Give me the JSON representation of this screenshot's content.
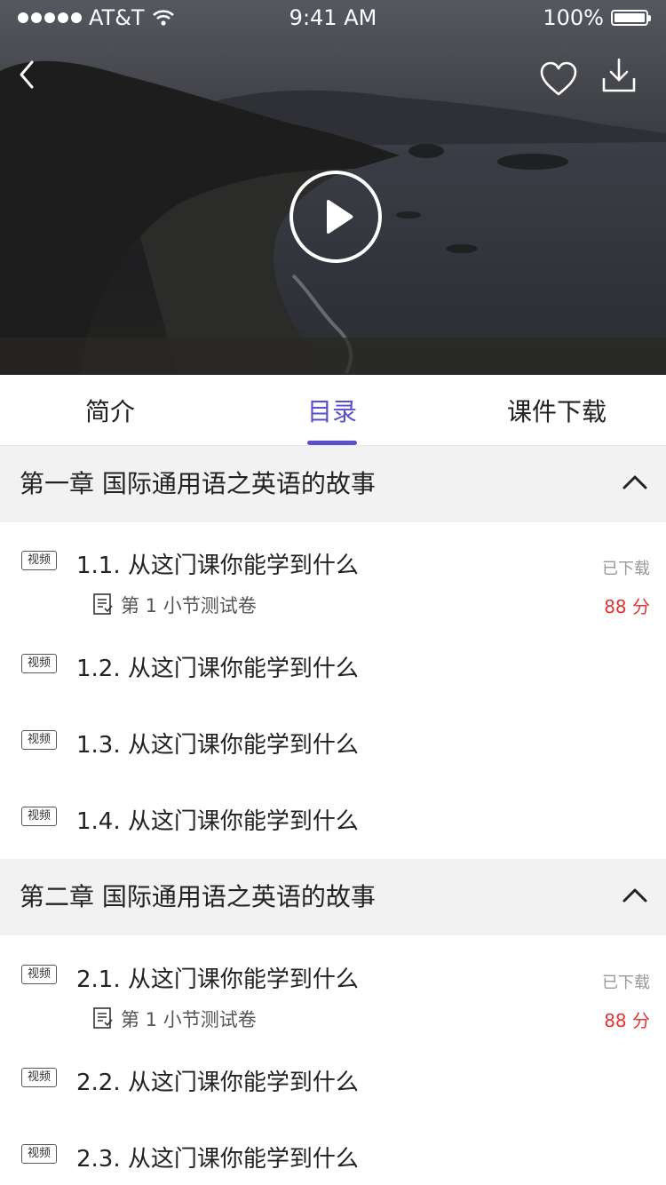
{
  "status_bar": {
    "carrier": "AT&T",
    "time": "9:41 AM",
    "battery": "100%"
  },
  "icons": {
    "back": "chevron-left-icon",
    "favorite": "heart-icon",
    "download": "download-icon",
    "play": "play-icon",
    "chevron_up": "chevron-up-icon",
    "quiz": "document-list-icon"
  },
  "tabs": [
    {
      "label": "简介",
      "active": false
    },
    {
      "label": "目录",
      "active": true
    },
    {
      "label": "课件下载",
      "active": false
    }
  ],
  "colors": {
    "accent": "#5a4fcf",
    "score": "#e63232",
    "chapter_bg": "#f2f2f2"
  },
  "chapters": [
    {
      "title": "第一章  国际通用语之英语的故事",
      "lessons": [
        {
          "badge": "视频",
          "title": "1.1. 从这门课你能学到什么",
          "status": "已下载",
          "quiz": "第 1 小节测试卷",
          "score": "88 分"
        },
        {
          "badge": "视频",
          "title": "1.2. 从这门课你能学到什么"
        },
        {
          "badge": "视频",
          "title": "1.3. 从这门课你能学到什么"
        },
        {
          "badge": "视频",
          "title": "1.4. 从这门课你能学到什么"
        }
      ]
    },
    {
      "title": "第二章  国际通用语之英语的故事",
      "lessons": [
        {
          "badge": "视频",
          "title": "2.1. 从这门课你能学到什么",
          "status": "已下载",
          "quiz": "第 1 小节测试卷",
          "score": "88 分"
        },
        {
          "badge": "视频",
          "title": "2.2. 从这门课你能学到什么"
        },
        {
          "badge": "视频",
          "title": "2.3. 从这门课你能学到什么"
        }
      ]
    }
  ]
}
